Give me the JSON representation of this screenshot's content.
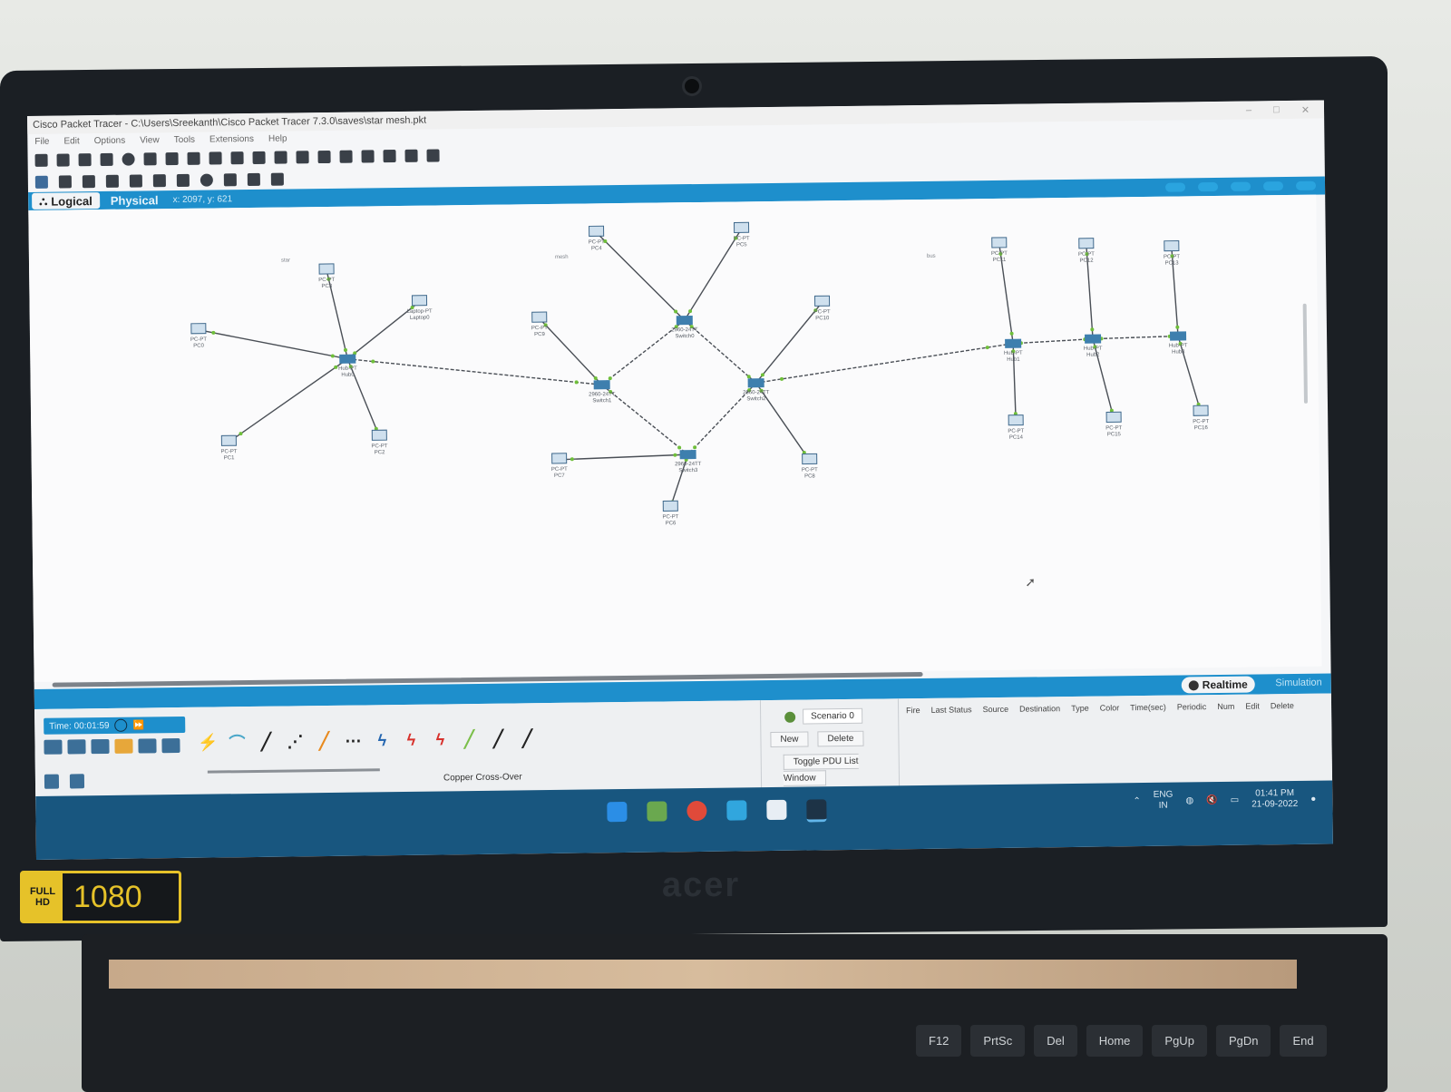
{
  "window": {
    "title": "Cisco Packet Tracer - C:\\Users\\Sreekanth\\Cisco Packet Tracer 7.3.0\\saves\\star mesh.pkt"
  },
  "menu": [
    "File",
    "Edit",
    "Options",
    "View",
    "Tools",
    "Extensions",
    "Help"
  ],
  "tabs": {
    "logical": "Logical",
    "physical": "Physical",
    "coords": "x: 2097, y: 621"
  },
  "mode": {
    "realtime": "Realtime",
    "simulation": "Simulation"
  },
  "time_label": "Time: 00:01:59",
  "selected_cable": "Copper Cross-Over",
  "pdu": {
    "scenario": "Scenario 0",
    "new": "New",
    "delete": "Delete",
    "toggle": "Toggle PDU List Window",
    "columns": [
      "Fire",
      "Last Status",
      "Source",
      "Destination",
      "Type",
      "Color",
      "Time(sec)",
      "Periodic",
      "Num",
      "Edit",
      "Delete"
    ]
  },
  "area_labels": {
    "star": "star",
    "mesh": "mesh",
    "bus": "bus"
  },
  "devices": {
    "pc0": "PC-PT PC0",
    "pc1": "PC-PT PC1",
    "pc2": "PC-PT PC2",
    "pc3": "PC-PT PC3",
    "laptop0": "Laptop-PT Laptop0",
    "hub0": "Hub-PT Hub0",
    "pc4": "PC-PT PC4",
    "pc5": "PC-PT PC5",
    "pc6": "PC-PT PC6",
    "pc7": "PC-PT PC7",
    "pc8": "PC-PT PC8",
    "pc9": "PC-PT PC9",
    "pc10": "PC-PT PC10",
    "switch0": "2960-24TT Switch0",
    "switch1": "2960-24TT Switch1",
    "switch2": "2960-24TT Switch2",
    "switch3": "2960-24TT Switch3",
    "pc11": "PC-PT PC11",
    "pc12": "PC-PT PC12",
    "pc13": "PC-PT PC13",
    "pc14": "PC-PT PC14",
    "pc15": "PC-PT PC15",
    "pc16": "PC-PT PC16",
    "hub1": "Hub-PT Hub1",
    "hub2": "Hub-PT Hub2",
    "hub3": "Hub-PT Hub3"
  },
  "tray": {
    "lang1": "ENG",
    "lang2": "IN",
    "time": "01:41 PM",
    "date": "21-09-2022"
  },
  "bezel": {
    "brand": "acer",
    "badge_top": "FULL",
    "badge_bottom": "HD",
    "resolution": "1080"
  },
  "keys": [
    "F12",
    "PrtSc",
    "Del",
    "Home",
    "PgUp",
    "PgDn",
    "End"
  ],
  "colors": {
    "accent": "#1e8fcc",
    "device": "#3e7fae",
    "link_solid": "#4a4f56",
    "taskbar": "#18567f"
  }
}
